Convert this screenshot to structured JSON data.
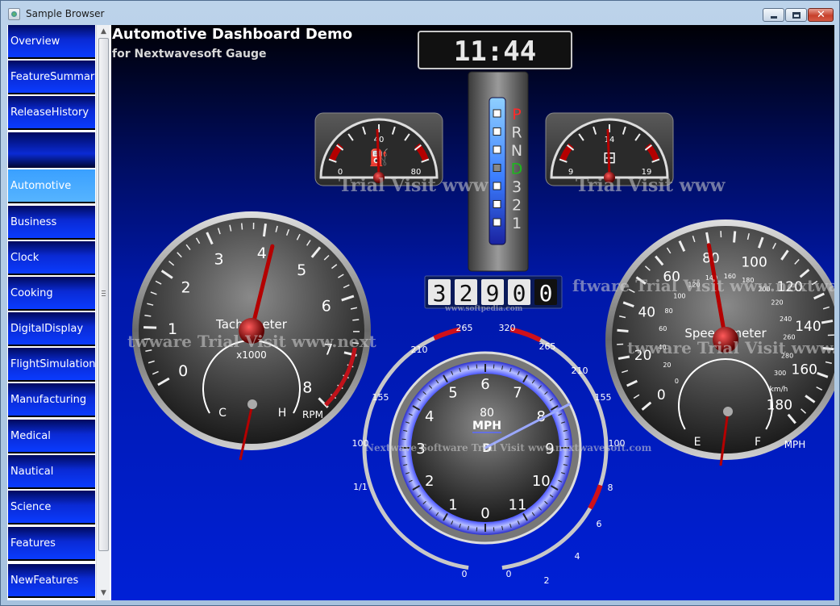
{
  "window": {
    "title": "Sample Browser"
  },
  "sidebar": {
    "items": [
      {
        "label": "Overview",
        "active": false
      },
      {
        "label": "FeatureSummary",
        "active": false
      },
      {
        "label": "ReleaseHistory",
        "active": false
      },
      {
        "label": "Automotive",
        "active": true
      },
      {
        "label": "Business",
        "active": false
      },
      {
        "label": "Clock",
        "active": false
      },
      {
        "label": "Cooking",
        "active": false
      },
      {
        "label": "DigitalDisplay",
        "active": false
      },
      {
        "label": "FlightSimulation",
        "active": false
      },
      {
        "label": "Manufacturing",
        "active": false
      },
      {
        "label": "Medical",
        "active": false
      },
      {
        "label": "Nautical",
        "active": false
      },
      {
        "label": "Science",
        "active": false
      },
      {
        "label": "Features",
        "active": false
      },
      {
        "label": "NewFeatures",
        "active": false
      }
    ]
  },
  "dashboard": {
    "title": "Automotive Dashboard Demo",
    "subtitle": "for Nextwavesoft Gauge",
    "top_display": "11:44",
    "odometer": [
      "3",
      "2",
      "9",
      "0",
      "0"
    ],
    "gear_letters": [
      "P",
      "R",
      "N",
      "D",
      "3",
      "2",
      "1"
    ],
    "selected_gear": "D",
    "oil_gauge": {
      "min_label": "0",
      "mid_label": "40",
      "max_label": "80",
      "value": 40
    },
    "battery_gauge": {
      "min_label": "9",
      "mid_label": "14",
      "max_label": "19",
      "value": 14
    },
    "tachometer": {
      "title": "Tachometer",
      "multiplier": "x1000",
      "unit": "RPM",
      "ticks": [
        "0",
        "1",
        "2",
        "3",
        "4",
        "5",
        "6",
        "7",
        "8"
      ],
      "value": 4.2,
      "temp_low": "C",
      "temp_high": "H"
    },
    "speedometer": {
      "title": "Speedometer",
      "mph_ticks": [
        "0",
        "20",
        "40",
        "60",
        "80",
        "100",
        "120",
        "140",
        "160",
        "180"
      ],
      "kmh_ticks": [
        "0",
        "20",
        "40",
        "60",
        "80",
        "100",
        "120",
        "140",
        "160",
        "180",
        "200",
        "220",
        "240",
        "260",
        "280",
        "300"
      ],
      "kmh_unit": "km/h",
      "mph_unit": "MPH",
      "fuel_low": "E",
      "fuel_high": "F",
      "value": 80
    },
    "center_gauge": {
      "speed": "80",
      "unit": "MPH",
      "gear": "D",
      "ticks": [
        "0",
        "1",
        "2",
        "3",
        "4",
        "5",
        "6",
        "7",
        "8",
        "9",
        "10",
        "11"
      ],
      "outer_top": [
        "210",
        "265",
        "320",
        "265",
        "210"
      ],
      "outer_left": [
        "155",
        "100"
      ],
      "outer_right": [
        "155",
        "100"
      ],
      "fuel_label": "1/1",
      "fuel_bottom": "0",
      "bottom_right": [
        "8",
        "6",
        "4",
        "2",
        "0"
      ]
    },
    "watermarks": [
      "Trial Visit www",
      "Trial Visit www",
      "twware Trial Visit www.next",
      "twware Trial Visit www.ne",
      "Nextwave Software Trial Visit www.nextwavesoft.com",
      "ftware Trial Visit www.nextwa",
      "www.softpedia.com"
    ]
  },
  "colors": {
    "accent_blue": "#0a3bff",
    "active_item": "#3aa0ff",
    "needle_red": "#c0121a"
  }
}
